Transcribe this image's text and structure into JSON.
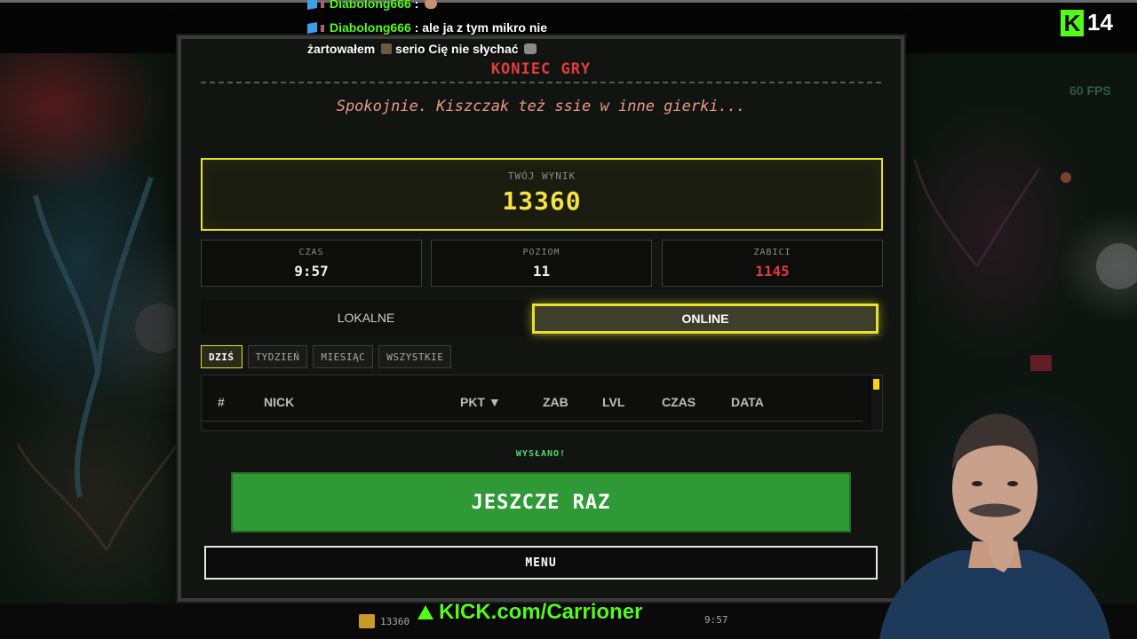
{
  "chat": {
    "messages": [
      {
        "user": "Diabolong666",
        "text": ":"
      },
      {
        "user": "Diabolong666",
        "text": ": ale ja z tym mikro nie",
        "continuation": "żartowałem",
        "continuation2": "serio Cię nie słychać"
      }
    ]
  },
  "overlay": {
    "viewer_count": "14",
    "fps": "60 FPS",
    "kick_banner": "KICK.com/Carrioner"
  },
  "game_over": {
    "title": "KONIEC GRY",
    "subtitle": "Spokojnie. Kiszczak też ssie w inne gierki...",
    "score_label": "TWÓJ WYNIK",
    "score_value": "13360",
    "stats": [
      {
        "label": "CZAS",
        "value": "9:57"
      },
      {
        "label": "POZIOM",
        "value": "11"
      },
      {
        "label": "ZABICI",
        "value": "1145"
      }
    ],
    "tabs": {
      "local": "LOKALNE",
      "online": "ONLINE"
    },
    "filters": [
      "DZIŚ",
      "TYDZIEŃ",
      "MIESIĄC",
      "WSZYSTKIE"
    ],
    "table_headers": [
      "#",
      "NICK",
      "PKT ▼",
      "ZAB",
      "LVL",
      "CZAS",
      "DATA"
    ],
    "status": "WYSŁANO!",
    "again_button": "JESZCZE RAZ",
    "menu_button": "MENU",
    "accent_color": "#e8e02a"
  },
  "hud": {
    "score": "13360",
    "time": "9:57"
  }
}
